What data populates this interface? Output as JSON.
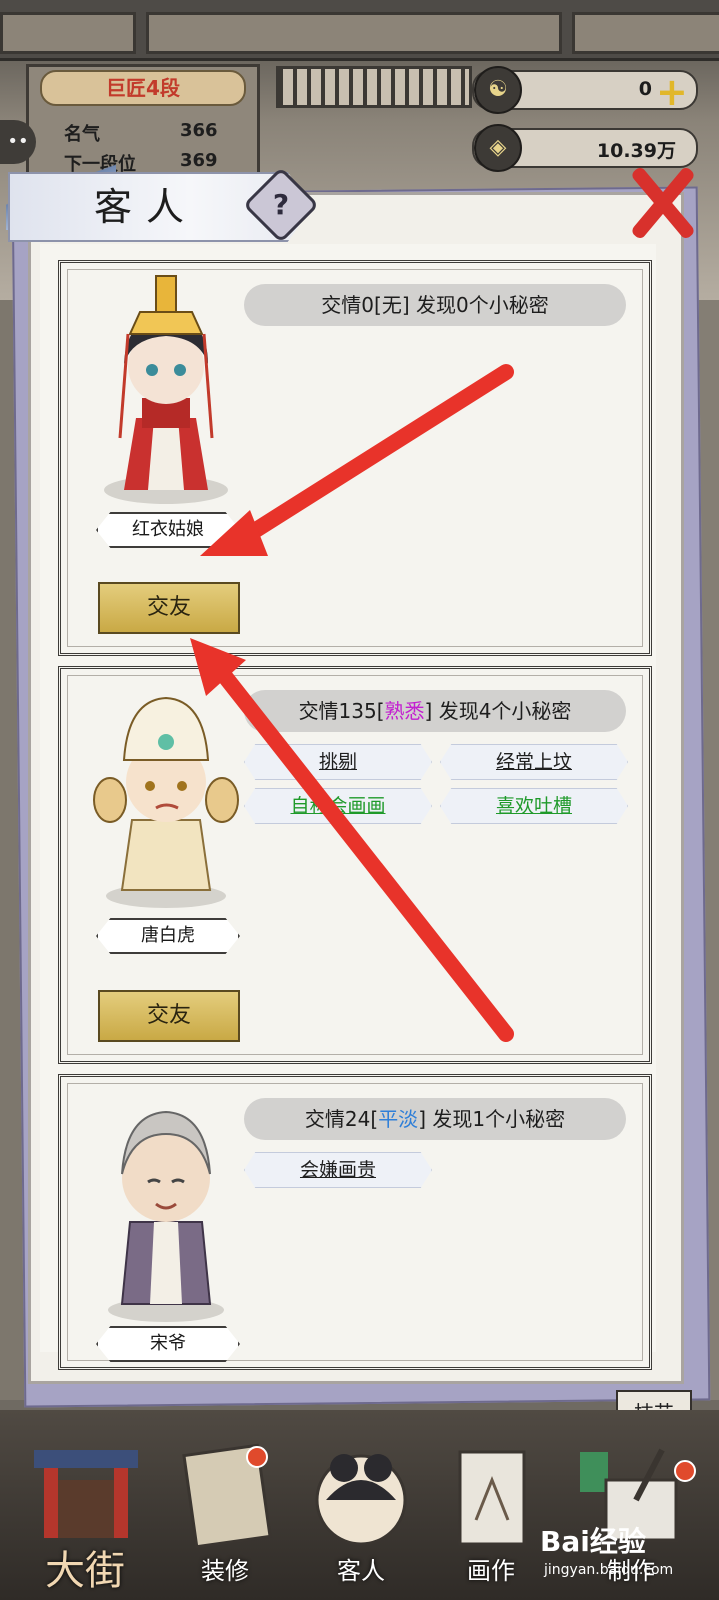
{
  "header": {
    "rank": "巨匠4段",
    "stats": [
      {
        "label": "名气",
        "value": "366"
      },
      {
        "label": "下一段位",
        "value": "369"
      }
    ],
    "resource_jade": "0",
    "resource_coins": "10.39万"
  },
  "panel": {
    "title": "客人",
    "help_symbol": "?"
  },
  "guests": [
    {
      "name": "红衣姑娘",
      "friendship": "交情0[",
      "level": "无",
      "friendship_tail": "] 发现0个小秘密",
      "secrets": [],
      "action": "交友"
    },
    {
      "name": "唐白虎",
      "friendship": "交情135[",
      "level": "熟悉",
      "friendship_tail": "] 发现4个小秘密",
      "secrets": [
        "挑剔",
        "经常上坟",
        "自称会画画",
        "喜欢吐槽"
      ],
      "action": "交友"
    },
    {
      "name": "宋爷",
      "friendship": "交情24[",
      "level": "平淡",
      "friendship_tail": "] 发现1个小秘密",
      "secrets": [
        "会嫌画贵"
      ],
      "action": ""
    }
  ],
  "skill_button": "技艺",
  "nav": [
    {
      "label": "大街"
    },
    {
      "label": "装修"
    },
    {
      "label": "客人"
    },
    {
      "label": "画作"
    },
    {
      "label": "制作"
    }
  ],
  "watermark": {
    "brand": "Bai经验",
    "url": "jingyan.baidu.com"
  },
  "colors": {
    "accent_gold": "#d2b455",
    "close_red": "#d8312c",
    "level_familiar": "#c320d0",
    "level_plain": "#2f7fd8",
    "secret_green": "#1f9a2a"
  }
}
